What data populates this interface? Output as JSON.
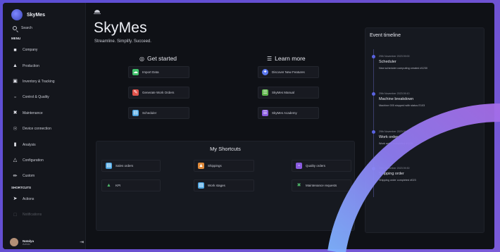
{
  "brand": {
    "name": "SkyMes"
  },
  "sidebar": {
    "search_label": "Search",
    "menu_title": "MENU",
    "items": [
      {
        "label": "Company",
        "icon": "building-icon"
      },
      {
        "label": "Production",
        "icon": "factory-icon"
      },
      {
        "label": "Inventory & Tracking",
        "icon": "boxes-icon"
      },
      {
        "label": "Control & Quality",
        "icon": "clipboard-icon"
      },
      {
        "label": "Maintenance",
        "icon": "wrench-icon"
      },
      {
        "label": "Device connection",
        "icon": "plug-icon"
      },
      {
        "label": "Analysis",
        "icon": "chart-icon"
      },
      {
        "label": "Configuration",
        "icon": "config-icon"
      },
      {
        "label": "Custom",
        "icon": "pencil-icon"
      }
    ],
    "shortcuts_title": "SHORTCUTS",
    "shortcut_items": [
      {
        "label": "Actions",
        "icon": "actions-icon"
      },
      {
        "label": "Notifications",
        "icon": "bell-icon"
      }
    ],
    "user": {
      "name": "Natalya",
      "role": "Admin"
    }
  },
  "header": {
    "title": "SkyMes",
    "subtitle": "Streamline. Simplify. Succeed."
  },
  "get_started": {
    "title": "Get started",
    "items": [
      {
        "label": "Import Data",
        "color": "#3fbf6a"
      },
      {
        "label": "Generate Work Orders",
        "color": "#e0524a"
      },
      {
        "label": "Scheduler",
        "color": "#4aa3e0"
      }
    ]
  },
  "learn_more": {
    "title": "Learn more",
    "items": [
      {
        "label": "Discover New Features",
        "color": "#5b78f0"
      },
      {
        "label": "SkyMes Manual",
        "color": "#5fb64a"
      },
      {
        "label": "SkyMes Academy",
        "color": "#8a5be0"
      }
    ]
  },
  "shortcuts": {
    "title": "My Shortcuts",
    "items": [
      {
        "label": "Sales orders",
        "color": "#4aa3e0"
      },
      {
        "label": "Shippings",
        "color": "#e08a3a"
      },
      {
        "label": "Quality orders",
        "color": "#8a5be0"
      },
      {
        "label": "KPI",
        "color": "#4fb86a"
      },
      {
        "label": "Work stages",
        "color": "#4aa3e0"
      },
      {
        "label": "Maintenance requests",
        "color": "#4fb86a"
      }
    ]
  },
  "timeline": {
    "title": "Event timeline",
    "events": [
      {
        "date": "29th November 2023 09:00",
        "name": "Scheduler",
        "desc": "New scheduler computing created #1230"
      },
      {
        "date": "29th November 2023 09:10",
        "name": "Machine breakdown",
        "desc": "Machine 005 stopped with status E103"
      },
      {
        "date": "29th November 2023 09:20",
        "name": "Work order",
        "desc": "Work order completed #1231"
      },
      {
        "date": "29th November 2023 09:30",
        "name": "Shipping order",
        "desc": "Shipping order completed #023"
      }
    ]
  }
}
